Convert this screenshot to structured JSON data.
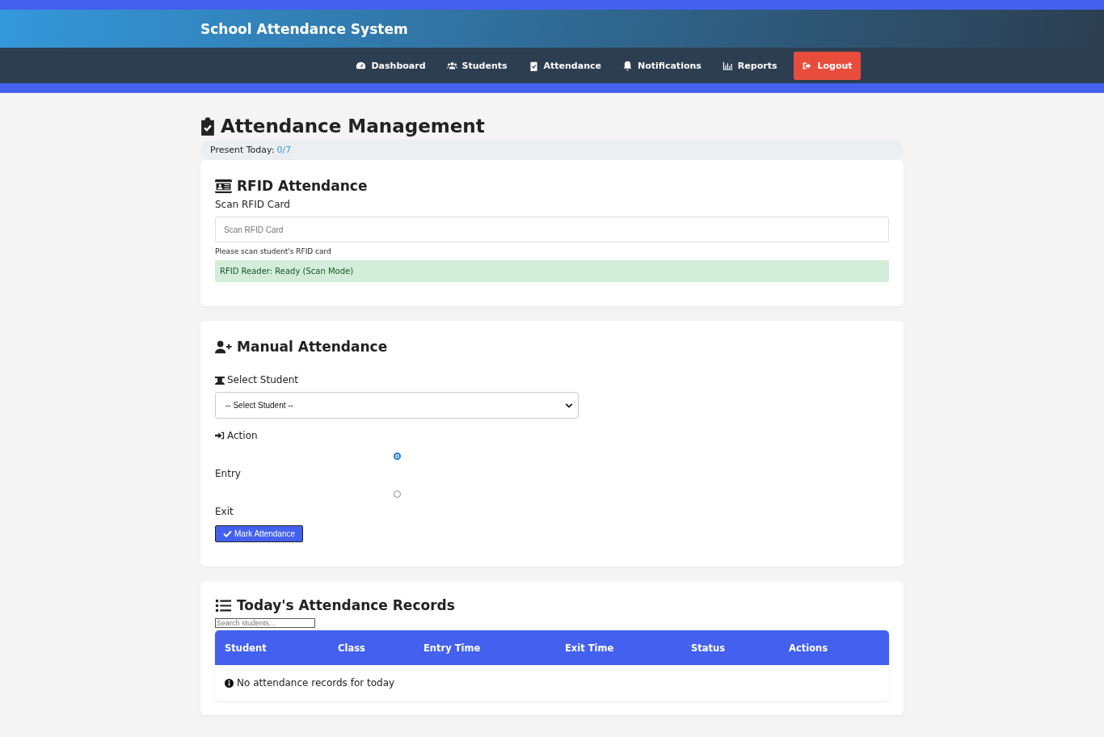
{
  "header": {
    "title": "School Attendance System"
  },
  "nav": [
    {
      "label": "Dashboard",
      "kind": "gauge"
    },
    {
      "label": "Students",
      "kind": "users"
    },
    {
      "label": "Attendance",
      "kind": "clipboard"
    },
    {
      "label": "Notifications",
      "kind": "bell"
    },
    {
      "label": "Reports",
      "kind": "chart"
    },
    {
      "label": "Logout",
      "kind": "logout"
    }
  ],
  "page": {
    "title": "Attendance Management",
    "present_label": "Present Today:",
    "present_value": "0/7"
  },
  "rfid": {
    "title": "RFID Attendance",
    "field_label": "Scan RFID Card",
    "placeholder": "Scan RFID Card",
    "hint": "Please scan student's RFID card",
    "status": "RFID Reader: Ready (Scan Mode)"
  },
  "manual": {
    "title": "Manual Attendance",
    "student_label": "Select Student",
    "student_select": "-- Select Student --",
    "action_label": "Action",
    "actions": [
      {
        "label": "Entry",
        "selected": true
      },
      {
        "label": "Exit",
        "selected": false
      }
    ],
    "submit": "Mark Attendance"
  },
  "records": {
    "title": "Today's Attendance Records",
    "search_placeholder": "Search students...",
    "columns": [
      "Student",
      "Class",
      "Entry Time",
      "Exit Time",
      "Status",
      "Actions"
    ],
    "empty": "No attendance records for today"
  }
}
